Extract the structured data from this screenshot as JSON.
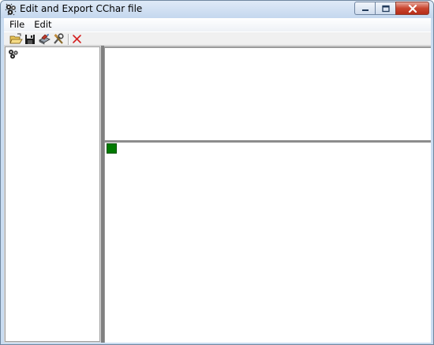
{
  "window": {
    "title": "Edit and Export CChar file",
    "app_icon": "gear-cluster-icon",
    "controls": [
      "minimize-icon",
      "maximize-icon",
      "close-icon"
    ]
  },
  "menubar": {
    "items": [
      {
        "label": "File"
      },
      {
        "label": "Edit"
      }
    ]
  },
  "toolbar": {
    "buttons": [
      "open-folder-icon",
      "save-disk-icon",
      "export-icon",
      "tools-icon",
      "delete-icon"
    ]
  },
  "tree": {
    "root_icon": "gear-cluster-icon"
  },
  "palette": {
    "swatch_color": "#007a00"
  }
}
